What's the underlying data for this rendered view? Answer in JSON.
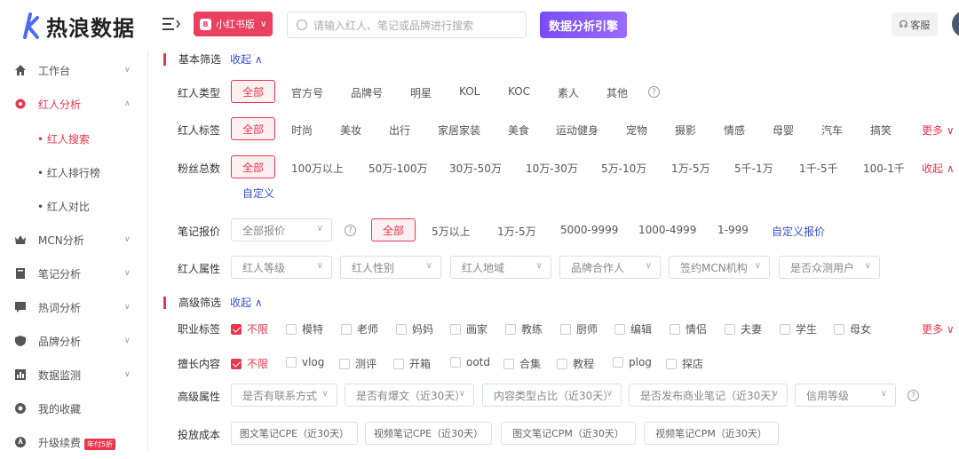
{
  "app": {
    "brand": "热浪数据"
  },
  "header": {
    "platform": "小红书版",
    "platform_badge": "B",
    "search_placeholder": "请输入红人、笔记或品牌进行搜索",
    "engine_button": "数据分析引擎",
    "support": "客服"
  },
  "sidebar": {
    "items": [
      {
        "label": "工作台",
        "icon": "home-icon"
      },
      {
        "label": "红人分析",
        "icon": "gear-icon"
      },
      {
        "label": "MCN分析",
        "icon": "crown-icon"
      },
      {
        "label": "笔记分析",
        "icon": "book-icon"
      },
      {
        "label": "热词分析",
        "icon": "comment-icon"
      },
      {
        "label": "品牌分析",
        "icon": "shield-icon"
      },
      {
        "label": "数据监测",
        "icon": "chart-icon"
      },
      {
        "label": "我的收藏",
        "icon": "star-icon"
      },
      {
        "label": "升级续费",
        "icon": "upgrade-icon",
        "promo": "年付5折"
      }
    ],
    "subitems": [
      "• 红人搜索",
      "• 红人排行榜",
      "• 红人对比"
    ]
  },
  "basic": {
    "title": "基本筛选",
    "collapse": "收起",
    "type": {
      "label": "红人类型",
      "options": [
        "全部",
        "官方号",
        "品牌号",
        "明星",
        "KOL",
        "KOC",
        "素人",
        "其他"
      ]
    },
    "tag": {
      "label": "红人标签",
      "options": [
        "全部",
        "时尚",
        "美妆",
        "出行",
        "家居家装",
        "美食",
        "运动健身",
        "宠物",
        "摄影",
        "情感",
        "母婴",
        "汽车",
        "搞笑"
      ],
      "more": "更多"
    },
    "fans": {
      "label": "粉丝总数",
      "options": [
        "全部",
        "100万以上",
        "50万-100万",
        "30万-50万",
        "10万-30万",
        "5万-10万",
        "1万-5万",
        "5千-1万",
        "1千-5千",
        "100-1千"
      ],
      "collapse": "收起",
      "custom": "自定义"
    },
    "price": {
      "label": "笔记报价",
      "dropdown": "全部报价",
      "options": [
        "全部",
        "5万以上",
        "1万-5万",
        "5000-9999",
        "1000-4999",
        "1-999"
      ],
      "custom": "自定义报价"
    },
    "attr": {
      "label": "红人属性",
      "dropdowns": [
        "红人等级",
        "红人性别",
        "红人地域",
        "品牌合作人",
        "签约MCN机构",
        "是否众测用户"
      ]
    }
  },
  "advanced": {
    "title": "高级筛选",
    "collapse": "收起",
    "job": {
      "label": "职业标签",
      "options": [
        "不限",
        "模特",
        "老师",
        "妈妈",
        "画家",
        "教练",
        "厨师",
        "编辑",
        "情侣",
        "夫妻",
        "学生",
        "母女"
      ],
      "more": "更多"
    },
    "content": {
      "label": "擅长内容",
      "options": [
        "不限",
        "vlog",
        "测评",
        "开箱",
        "ootd",
        "合集",
        "教程",
        "plog",
        "探店"
      ]
    },
    "attr": {
      "label": "高级属性",
      "dropdowns": [
        "是否有联系方式",
        "是否有爆文（近30天）",
        "内容类型占比（近30天）",
        "是否发布商业笔记（近30天）",
        "信用等级"
      ]
    },
    "cost": {
      "label": "投放成本",
      "buttons": [
        "图文笔记CPE（近30天）",
        "视频笔记CPE（近30天）",
        "图文笔记CPM（近30天）",
        "视频笔记CPM（近30天）"
      ]
    }
  },
  "colors": {
    "accent": "#e8364f",
    "link": "#3453d1",
    "engine": "#8a5cf9"
  }
}
